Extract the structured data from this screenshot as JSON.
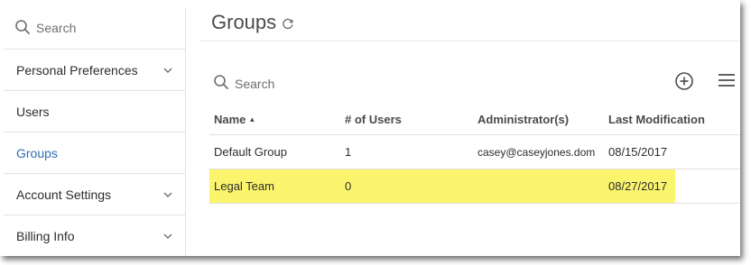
{
  "sidebar": {
    "search_placeholder": "Search",
    "items": [
      {
        "label": "Personal Preferences",
        "has_chevron": true
      },
      {
        "label": "Users",
        "has_chevron": false
      },
      {
        "label": "Groups",
        "has_chevron": false,
        "active": true
      },
      {
        "label": "Account Settings",
        "has_chevron": true
      },
      {
        "label": "Billing Info",
        "has_chevron": true
      }
    ]
  },
  "main": {
    "title": "Groups",
    "search_placeholder": "Search",
    "icons": [
      "refresh-icon",
      "add-circle-icon",
      "hamburger-menu-icon"
    ]
  },
  "table": {
    "columns": [
      "Name",
      "# of Users",
      "Administrator(s)",
      "Last Modification"
    ],
    "sort_indicator": "▲",
    "rows": [
      {
        "name": "Default Group",
        "users": "1",
        "admin": "casey@caseyjones.dom",
        "modified": "08/15/2017",
        "highlighted": false
      },
      {
        "name": "Legal Team",
        "users": "0",
        "admin": "",
        "modified": "08/27/2017",
        "highlighted": true
      }
    ]
  },
  "colors": {
    "active_nav": "#2d6db5",
    "highlight": "#fbf46d",
    "divider": "#e1e1e1"
  }
}
